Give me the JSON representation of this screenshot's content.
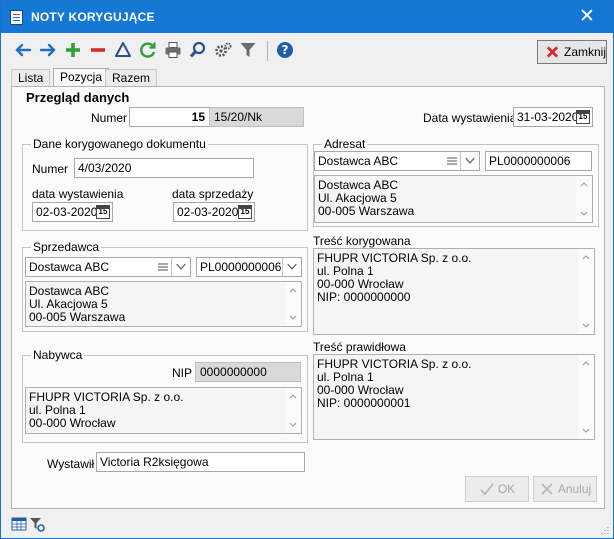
{
  "window": {
    "title": "NOTY KORYGUJĄCE"
  },
  "toolbar": {
    "icons": [
      "arrow-left-icon",
      "arrow-right-icon",
      "plus-icon",
      "minus-icon",
      "delta-icon",
      "refresh-icon",
      "printer-icon",
      "search-icon",
      "gears-icon",
      "filter-icon",
      "help-icon"
    ],
    "close_label": "Zamknij"
  },
  "tabs": [
    "Lista",
    "Pozycja",
    "Razem"
  ],
  "active_tab": "Pozycja",
  "overview": {
    "heading": "Przegląd danych",
    "numer_label": "Numer",
    "numer_value": "15",
    "numer_full": "15/20/Nk",
    "data_wyst_label": "Data wystawienia",
    "data_wyst_value": "31-03-2020"
  },
  "corrected_doc": {
    "legend": "Dane korygowanego dokumentu",
    "numer_label": "Numer",
    "numer_value": "4/03/2020",
    "data_wyst_label": "data wystawienia",
    "data_wyst_value": "02-03-2020",
    "data_sprz_label": "data sprzedaży",
    "data_sprz_value": "02-03-2020"
  },
  "adresat": {
    "legend": "Adresat",
    "name": "Dostawca ABC",
    "nip": "PL0000000006",
    "address": [
      "Dostawca ABC",
      "Ul. Akacjowa 5",
      "00-005 Warszawa"
    ]
  },
  "sprzedawca": {
    "legend": "Sprzedawca",
    "name": "Dostawca ABC",
    "nip": "PL0000000006",
    "address": [
      "Dostawca ABC",
      "Ul. Akacjowa 5",
      "00-005 Warszawa"
    ]
  },
  "tresc_korygowana": {
    "label": "Treść korygowana",
    "lines": [
      "FHUPR VICTORIA Sp. z o.o.",
      "ul. Polna 1",
      "00-000 Wrocław",
      "NIP: 0000000000"
    ]
  },
  "nabywca": {
    "legend": "Nabywca",
    "nip_label": "NIP",
    "nip_value": "0000000000",
    "address": [
      "FHUPR VICTORIA Sp. z o.o.",
      "ul. Polna 1",
      "00-000 Wrocław"
    ]
  },
  "tresc_prawidlowa": {
    "label": "Treść prawidłowa",
    "lines": [
      "FHUPR VICTORIA Sp. z o.o.",
      "ul. Polna 1",
      "00-000 Wrocław",
      "NIP: 0000000001"
    ]
  },
  "wystawil": {
    "label": "Wystawił",
    "value": "Victoria R2księgowa"
  },
  "buttons": {
    "ok": "OK",
    "cancel": "Anuluj"
  },
  "colors": {
    "titlebar": "#1478d4",
    "plus": "#2e9e3a",
    "minus": "#d92b2b",
    "arrows": "#1f6fc5"
  }
}
